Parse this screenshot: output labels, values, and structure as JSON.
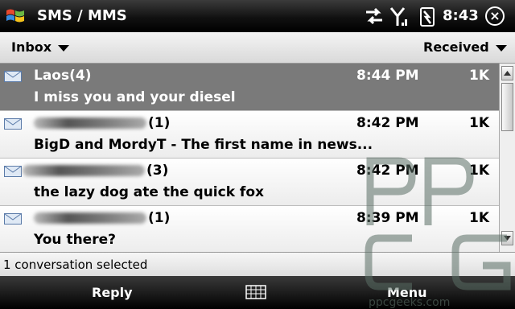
{
  "titlebar": {
    "title": "SMS / MMS",
    "time": "8:43",
    "close_label": "×"
  },
  "filter": {
    "folder": "Inbox",
    "sort": "Received"
  },
  "messages": [
    {
      "sender": "Laos",
      "count": "(4)",
      "time": "8:44 PM",
      "size": "1K",
      "preview": "I miss you and your diesel",
      "selected": true
    },
    {
      "sender": "",
      "count": "(1)",
      "time": "8:42 PM",
      "size": "1K",
      "preview": "BigD and MordyT - The first name in news...",
      "selected": false
    },
    {
      "sender": "",
      "count": "(3)",
      "time": "8:42 PM",
      "size": "1K",
      "preview": "the lazy dog ate the quick fox",
      "selected": false
    },
    {
      "sender": "",
      "count": "(1)",
      "time": "8:39 PM",
      "size": "1K",
      "preview": "You there?",
      "selected": false
    }
  ],
  "status": {
    "text": "1 conversation selected"
  },
  "softkeys": {
    "left": "Reply",
    "right": "Menu"
  },
  "watermark": {
    "letters": "PPCG",
    "url": "ppcgeeks.com"
  },
  "colors": {
    "selected_row": "#7a7a7a",
    "title_bar": "#111111"
  }
}
